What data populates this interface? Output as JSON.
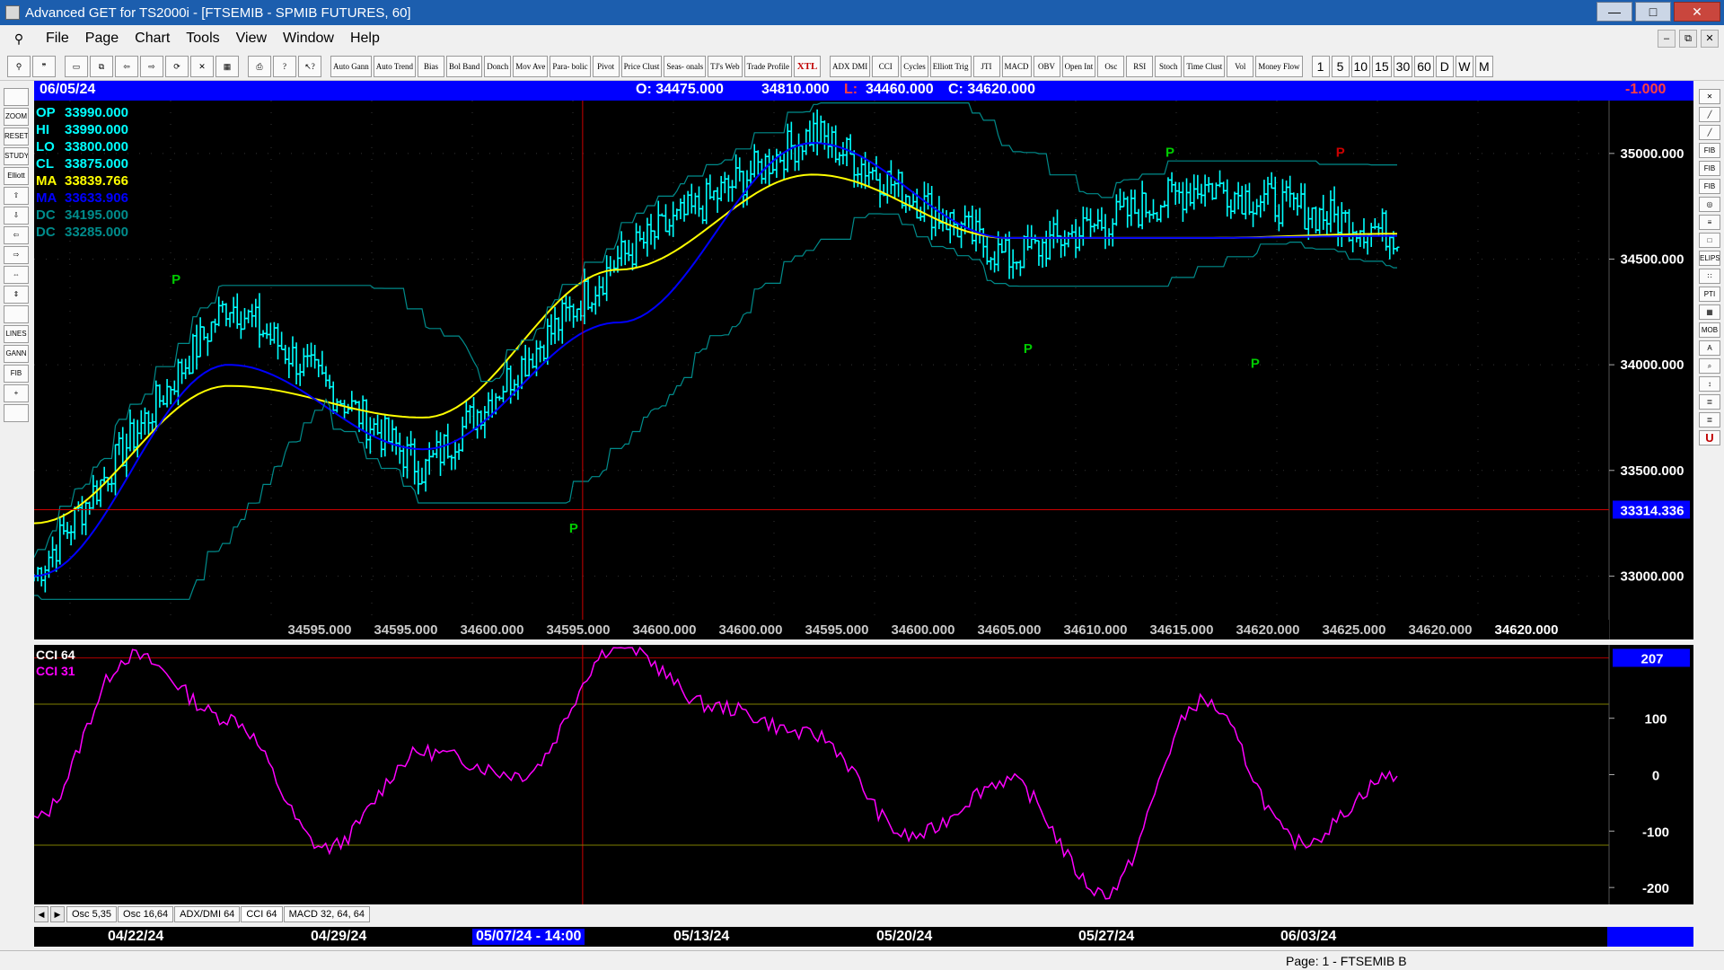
{
  "window": {
    "title": "Advanced GET for TS2000i - [FTSEMIB - SPMIB FUTURES, 60]",
    "min_label": "—",
    "max_label": "□",
    "close_label": "✕"
  },
  "menu": {
    "items": [
      "File",
      "Page",
      "Chart",
      "Tools",
      "View",
      "Window",
      "Help"
    ],
    "mdi": [
      "–",
      "⧉",
      "✕"
    ]
  },
  "toolbar": {
    "studies": [
      {
        "label": "Auto Gann"
      },
      {
        "label": "Auto Trend"
      },
      {
        "label": "Bias"
      },
      {
        "label": "Bol Band"
      },
      {
        "label": "Donch"
      },
      {
        "label": "Mov Ave"
      },
      {
        "label": "Para- bolic"
      },
      {
        "label": "Pivot"
      },
      {
        "label": "Price Clust"
      },
      {
        "label": "Seas- onals"
      },
      {
        "label": "TJ's Web"
      },
      {
        "label": "Trade Profile"
      },
      {
        "label": "XTL"
      }
    ],
    "oscillators": [
      {
        "label": "ADX DMI"
      },
      {
        "label": "CCI"
      },
      {
        "label": "Cycles"
      },
      {
        "label": "Elliott Trig"
      },
      {
        "label": "JTI"
      },
      {
        "label": "MACD"
      },
      {
        "label": "OBV"
      },
      {
        "label": "Open Int"
      },
      {
        "label": "Osc"
      },
      {
        "label": "RSI"
      },
      {
        "label": "Stoch"
      },
      {
        "label": "Time Clust"
      },
      {
        "label": "Vol"
      },
      {
        "label": "Money Flow"
      }
    ],
    "periods": [
      "1",
      "5",
      "10",
      "15",
      "30",
      "60",
      "D",
      "W",
      "M"
    ]
  },
  "left_tools": [
    "",
    "ZOOM",
    "RESET",
    "STUDY",
    "Elliott",
    "⇧",
    "⇩",
    "⇦",
    "⇨",
    "⇔",
    "⇕",
    "",
    "LINES",
    "GANN",
    "FIB",
    "+",
    ""
  ],
  "right_tools": [
    "✕",
    "╱",
    "╱",
    "FIB RET",
    "FIB EXT",
    "FIB TIME",
    "◎",
    "≡",
    "□",
    "ELIPS",
    "∷",
    "PTI",
    "▦",
    "MOB",
    "A",
    "⌕",
    "↕",
    "≣",
    "≣",
    "U"
  ],
  "ohlc_bar": {
    "date": "06/05/24",
    "open": "O: 34475.000",
    "high": "34810.000",
    "low_prefix": "L:",
    "low": "34460.000",
    "close": "C: 34620.000",
    "change": "-1.000"
  },
  "info_panel": [
    {
      "label": "OP",
      "value": "33990.000",
      "color": "#00ffff"
    },
    {
      "label": "HI",
      "value": "33990.000",
      "color": "#00ffff"
    },
    {
      "label": "LO",
      "value": "33800.000",
      "color": "#00ffff"
    },
    {
      "label": "CL",
      "value": "33875.000",
      "color": "#00ffff"
    },
    {
      "label": "MA",
      "value": "33839.766",
      "color": "#ffff00"
    },
    {
      "label": "MA",
      "value": "33633.906",
      "color": "#0000ff"
    },
    {
      "label": "DC",
      "value": "34195.000",
      "color": "#008b8b"
    },
    {
      "label": "DC",
      "value": "33285.000",
      "color": "#008b8b"
    }
  ],
  "price_axis": {
    "labels": [
      "35000.000",
      "34500.000",
      "34000.000",
      "33500.000",
      "33000.000"
    ],
    "cursor_price": "33314.336"
  },
  "bottom_values": [
    "34595.000",
    "34595.000",
    "34600.000",
    "34595.000",
    "34600.000",
    "34600.000",
    "34595.000",
    "34600.000",
    "34605.000",
    "34610.000",
    "34615.000",
    "34620.000",
    "34625.000",
    "34620.000",
    "34620.000"
  ],
  "pivot_labels": [
    {
      "label": "P"
    },
    {
      "label": "P"
    },
    {
      "label": "P"
    },
    {
      "label": "P"
    },
    {
      "label": "P"
    },
    {
      "label": "P"
    }
  ],
  "cci_panel": {
    "title": "CCI 64",
    "subtitle": "CCI  31",
    "current": "207",
    "axis_labels": [
      "100",
      "0",
      "-100",
      "-200"
    ],
    "title_color": "#ffffff",
    "subtitle_color": "#ff00ff",
    "line_color": "#ff00ff"
  },
  "tabs": [
    {
      "label": "Osc 5,35"
    },
    {
      "label": "Osc 16,64"
    },
    {
      "label": "ADX/DMI 64"
    },
    {
      "label": "CCI 64"
    },
    {
      "label": "MACD 32, 64, 64"
    }
  ],
  "tab_arrows": [
    "◀",
    "▶"
  ],
  "dates": [
    "04/22/24",
    "04/29/24",
    "05/07/24 - 14:00",
    "05/13/24",
    "05/20/24",
    "05/27/24",
    "06/03/24"
  ],
  "status": "Page: 1 - FTSEMIB B",
  "colors": {
    "price_bars": "#00ffff",
    "ma_fast": "#ffff00",
    "ma_slow": "#0000ff",
    "donchian": "#008b8b",
    "pivot_green": "#00cc00",
    "pivot_red": "#cc0000",
    "cursor": "#cc0000"
  },
  "chart_data": [
    {
      "type": "line",
      "title": "FTSEMIB - SPMIB FUTURES, 60",
      "ylim": [
        32700,
        35250
      ],
      "x": [
        "04/22/24",
        "04/29/24",
        "05/07/24",
        "05/13/24",
        "05/20/24",
        "05/27/24",
        "06/03/24",
        "06/05/24"
      ],
      "series": [
        {
          "values": [
            33000,
            34300,
            33500,
            34500,
            35100,
            34500,
            34850,
            34620
          ]
        },
        {
          "values": [
            33250,
            33900,
            33750,
            34450,
            34900,
            34600,
            34600,
            34620
          ]
        },
        {
          "values": [
            33000,
            34000,
            33600,
            34200,
            35050,
            34600,
            34600,
            34610
          ]
        }
      ],
      "pivots": [
        {
          "date": "04/23/24",
          "price": 34350,
          "kind": "high"
        },
        {
          "date": "05/07/24",
          "price": 33300,
          "kind": "low"
        },
        {
          "date": "05/23/24",
          "price": 34150,
          "kind": "low"
        },
        {
          "date": "05/28/24",
          "price": 34950,
          "kind": "high"
        },
        {
          "date": "05/31/24",
          "price": 34080,
          "kind": "low"
        },
        {
          "date": "06/03/24",
          "price": 34950,
          "kind": "high"
        }
      ]
    },
    {
      "type": "line",
      "title": "CCI 64",
      "ylim": [
        -230,
        230
      ],
      "x": [
        "04/22/24",
        "04/24/24",
        "04/29/24",
        "05/02/24",
        "05/07/24",
        "05/10/24",
        "05/13/24",
        "05/17/24",
        "05/20/24",
        "05/24/24",
        "05/27/24",
        "05/30/24",
        "06/03/24",
        "06/04/24",
        "06/05/24"
      ],
      "series": [
        {
          "values": [
            -80,
            210,
            100,
            -130,
            40,
            0,
            230,
            120,
            70,
            -110,
            -10,
            -210,
            130,
            -120,
            0
          ]
        }
      ]
    }
  ]
}
